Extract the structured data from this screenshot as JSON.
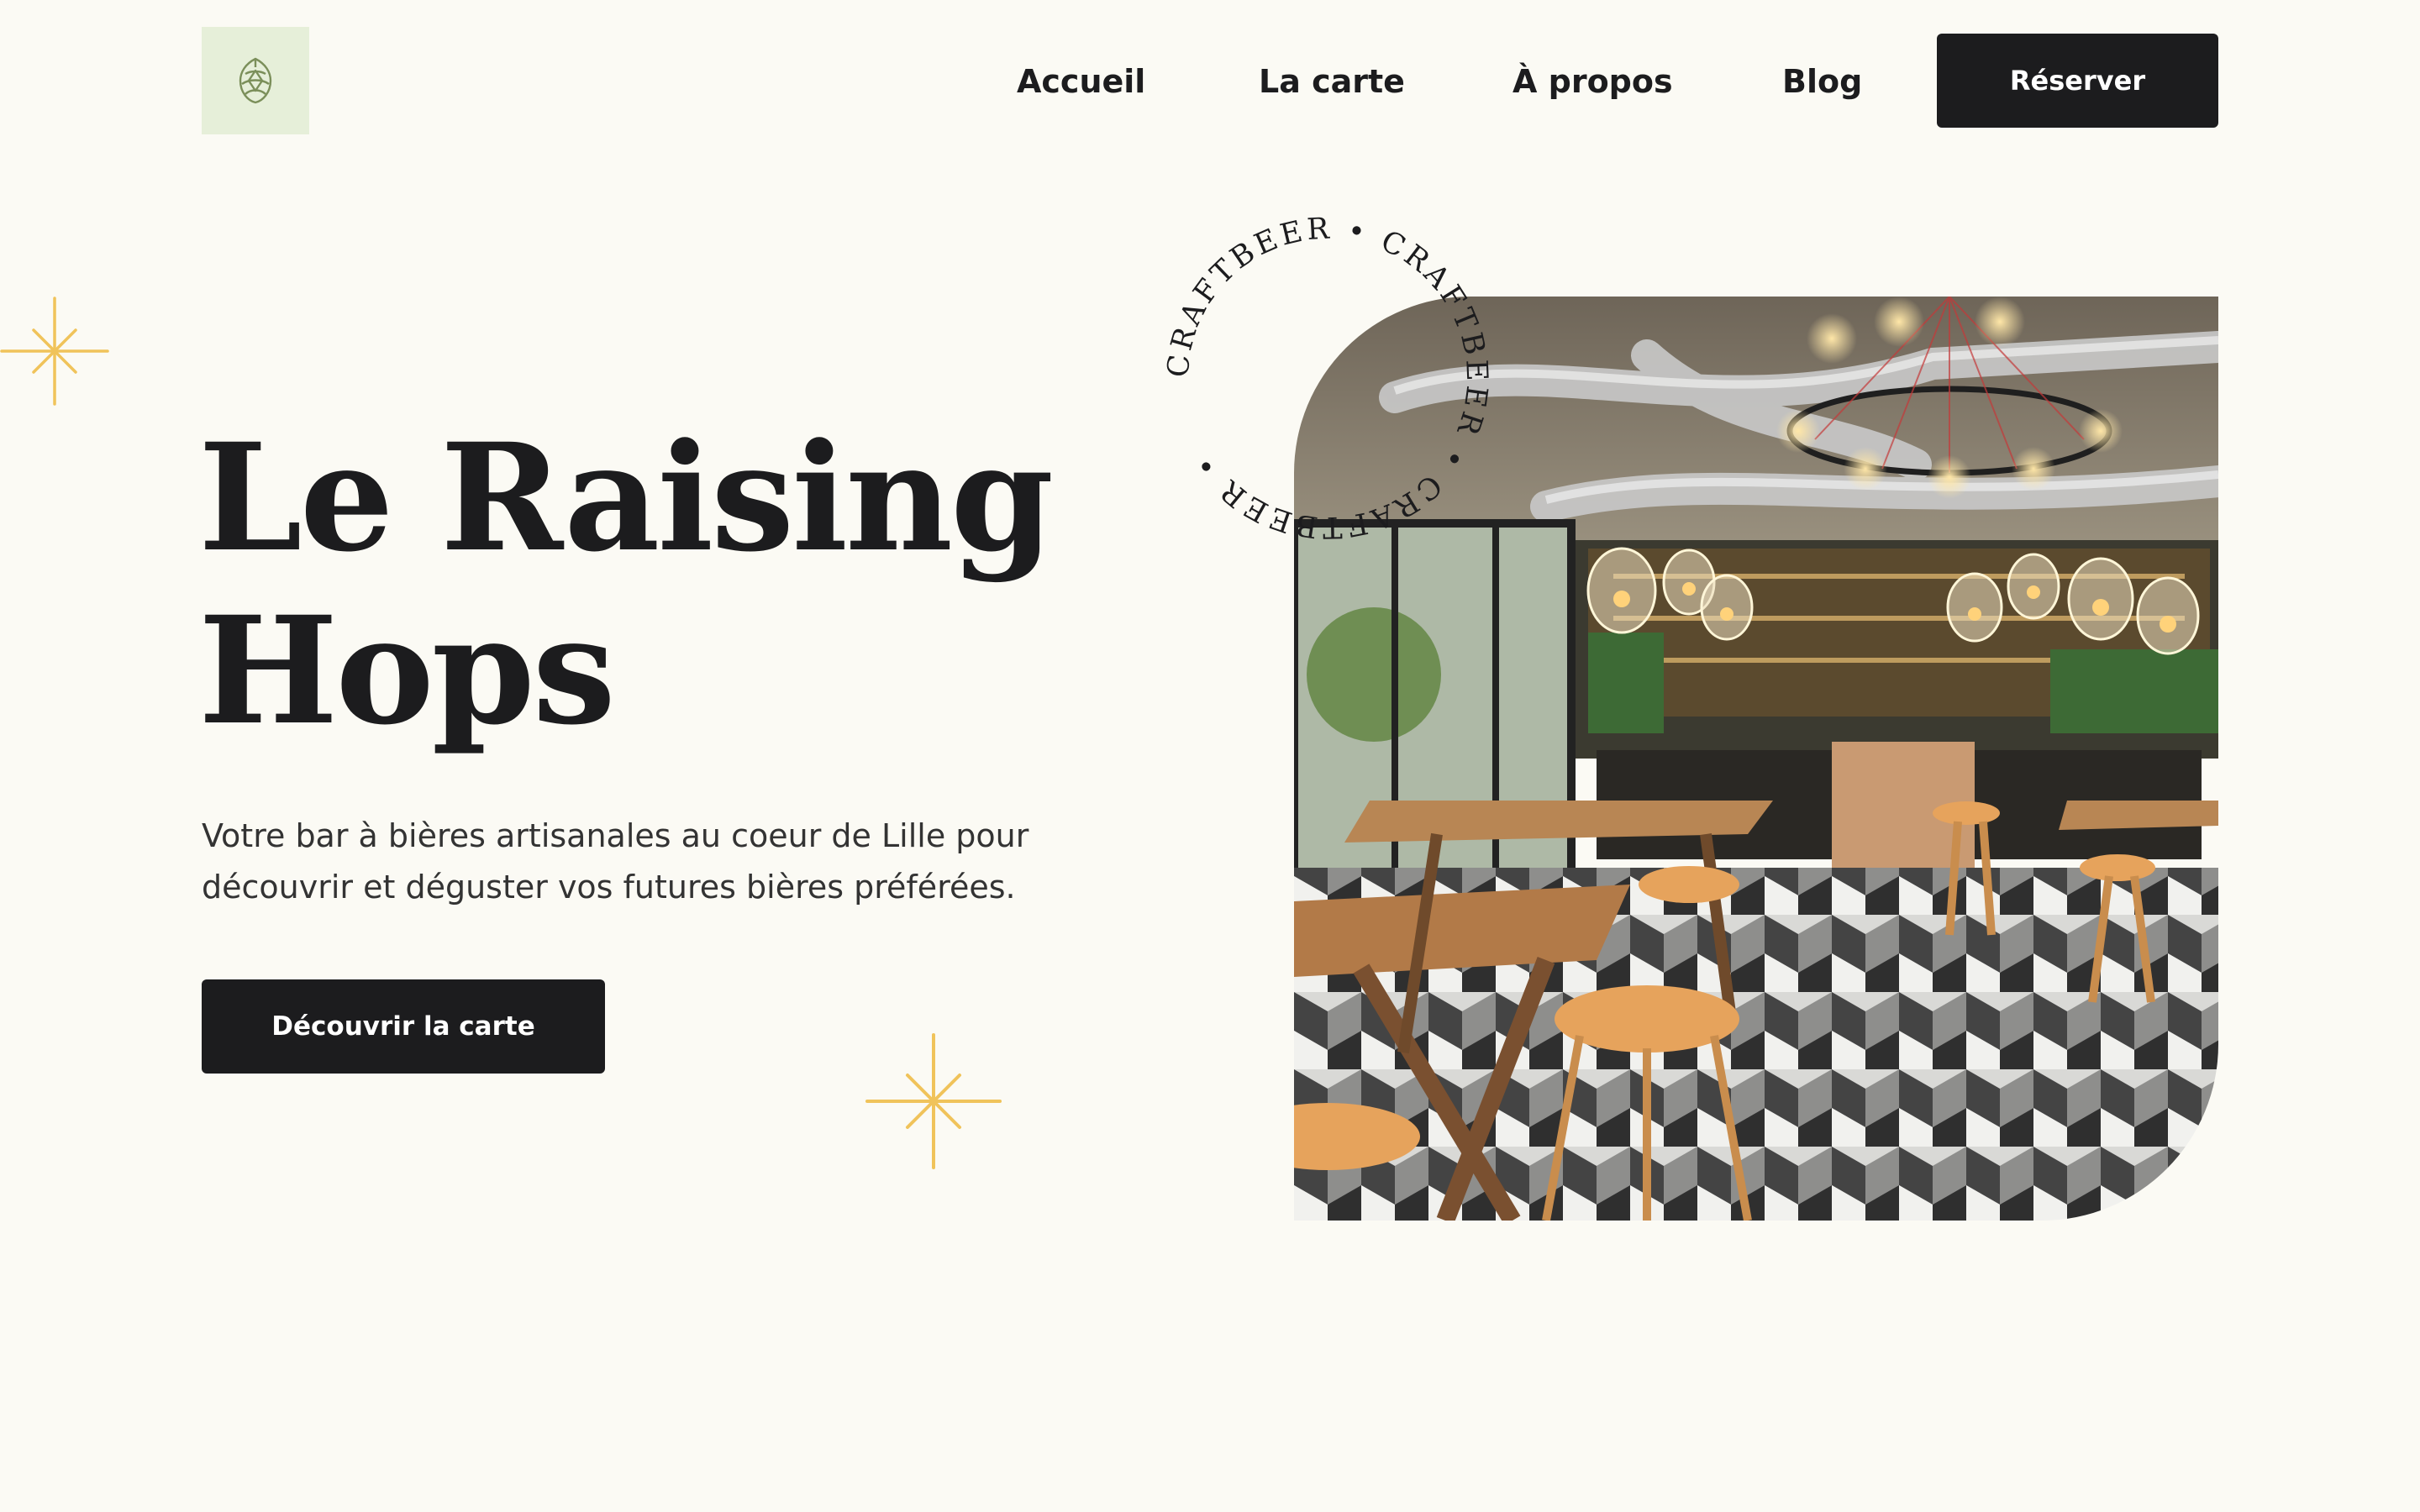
{
  "header": {
    "logo_icon": "hop-icon",
    "nav": [
      {
        "label": "Accueil"
      },
      {
        "label": "La carte"
      },
      {
        "label": "À propos"
      },
      {
        "label": "Blog"
      }
    ],
    "reserve_label": "Réserver"
  },
  "hero": {
    "title_line1": "Le Raising",
    "title_line2": "Hops",
    "subtitle_line1": "Votre bar à bières artisanales au coeur de Lille pour",
    "subtitle_line2": "découvrir et déguster vos futures bières préférées.",
    "cta_label": "Découvrir la carte",
    "badge_text": "CRAFTBEER • CRAFTBEER • CRAFTBEER • ",
    "photo_icon": "bar-interior-photo",
    "sparkle_icon": "sparkle-icon"
  },
  "colors": {
    "background": "#fbfaf4",
    "dark": "#1c1c1e",
    "logo_bg": "#e6efd9",
    "sparkle": "#f0c35a"
  }
}
